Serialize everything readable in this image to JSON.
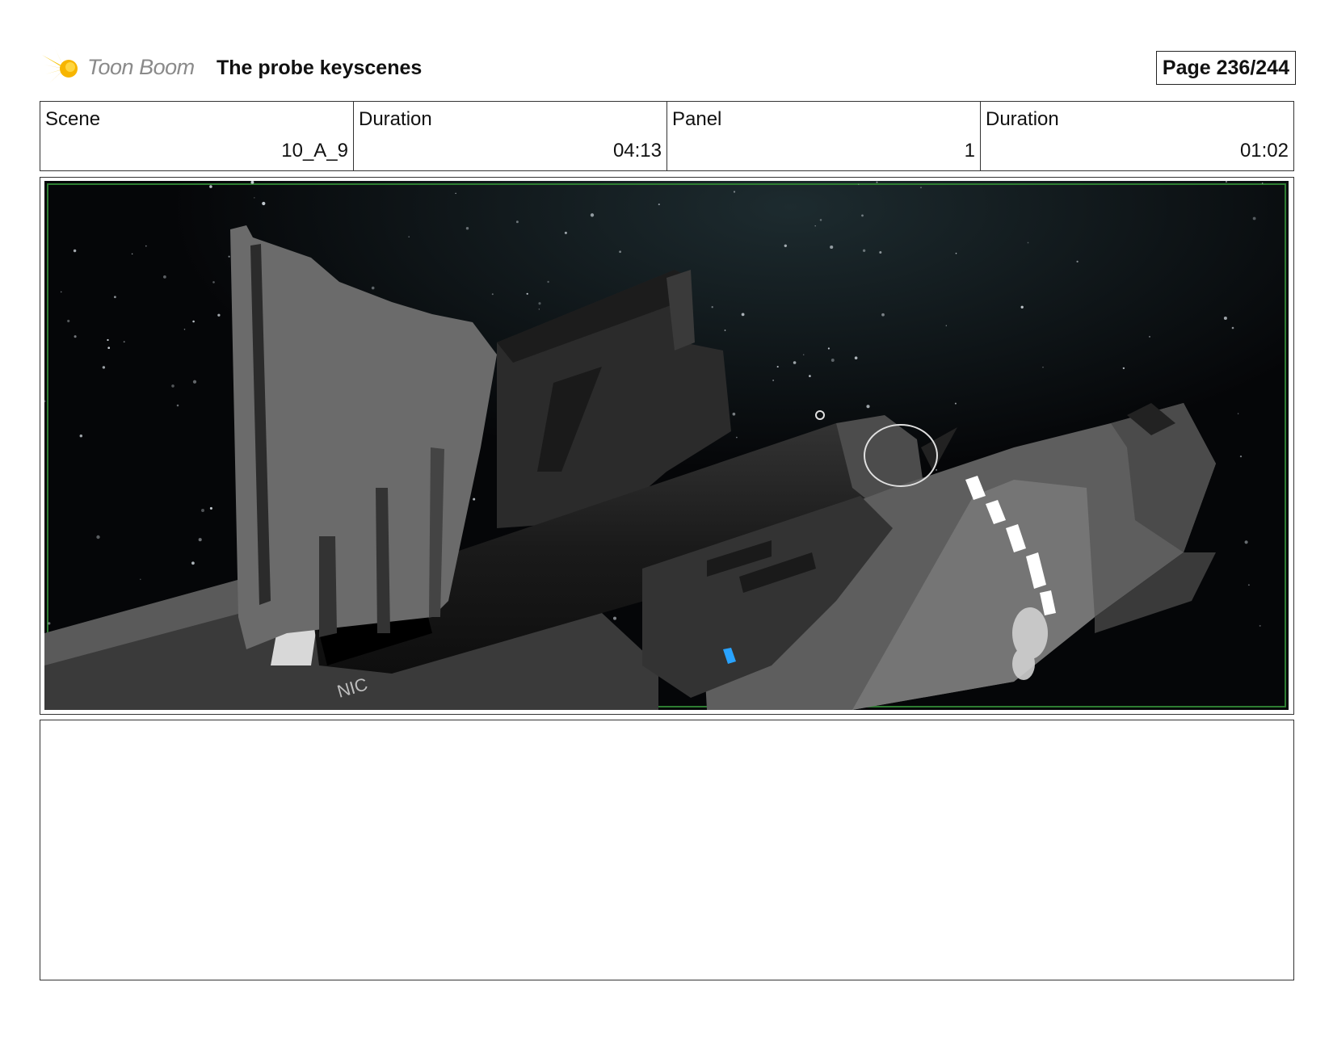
{
  "header": {
    "logo_text": "Toon Boom",
    "title": "The probe keyscenes",
    "page_label": "Page 236/244"
  },
  "info": {
    "scene_label": "Scene",
    "scene_value": "10_A_9",
    "duration_label": "Duration",
    "duration_value": "04:13",
    "panel_label": "Panel",
    "panel_value": "1",
    "panel_duration_label": "Duration",
    "panel_duration_value": "01:02"
  },
  "panel": {
    "image_icon": "spaceship-in-space-illustration",
    "ship_marking": "NIC"
  },
  "colors": {
    "logo_accent": "#f5b800",
    "space_bg": "#050608",
    "hull_dark": "#2a2a2a",
    "hull_light": "#6e6e6e",
    "frame_green": "#2e7d32"
  }
}
